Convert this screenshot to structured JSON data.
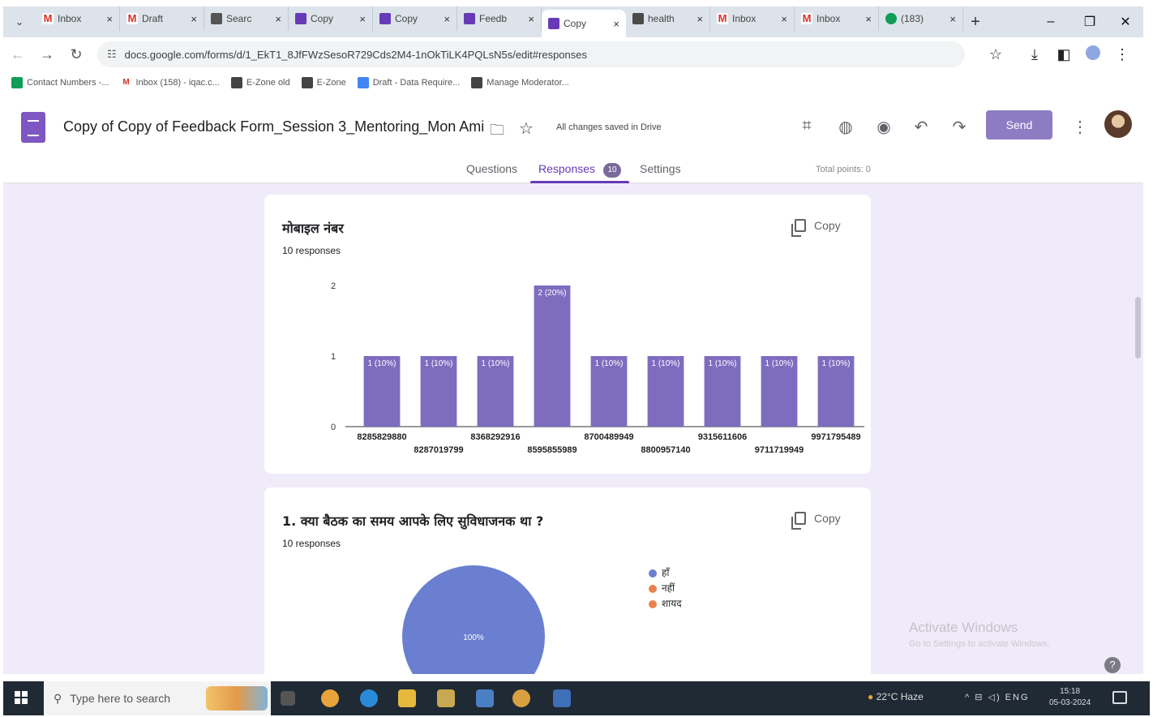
{
  "browser": {
    "tab_search_icon": "chevron-down-icon",
    "tabs": [
      {
        "label": "Inbox",
        "icon": "gmail"
      },
      {
        "label": "Draft",
        "icon": "gmail"
      },
      {
        "label": "Searc",
        "icon": "drive"
      },
      {
        "label": "Copy",
        "icon": "forms"
      },
      {
        "label": "Copy",
        "icon": "forms"
      },
      {
        "label": "Feedb",
        "icon": "forms"
      },
      {
        "label": "Copy",
        "icon": "forms",
        "active": true
      },
      {
        "label": "health",
        "icon": "docs"
      },
      {
        "label": "Inbox",
        "icon": "gmail"
      },
      {
        "label": "Inbox",
        "icon": "gmail"
      },
      {
        "label": "(183)",
        "icon": "web"
      }
    ],
    "tab_close": "×",
    "new_tab": "+",
    "window_controls": {
      "minimize": "–",
      "restore": "❐",
      "close": "✕"
    },
    "url": "docs.google.com/forms/d/1_EkT1_8JfFWzSesoR729Cds2M4-1nOkTiLK4PQLsN5s/edit#responses",
    "bookmarks": [
      {
        "label": "Contact Numbers -...",
        "icon": "sheets",
        "color": "#0f9d58"
      },
      {
        "label": "Inbox (158) - iqac.c...",
        "icon": "gmail",
        "color": "#d93025"
      },
      {
        "label": "E-Zone old",
        "icon": "bookmark",
        "color": "#444"
      },
      {
        "label": "E-Zone",
        "icon": "bookmark",
        "color": "#444"
      },
      {
        "label": "Draft - Data Require...",
        "icon": "docs",
        "color": "#4285f4"
      },
      {
        "label": "Manage Moderator...",
        "icon": "bookmark",
        "color": "#444"
      }
    ]
  },
  "form": {
    "title": "Copy of Copy of Feedback Form_Session 3_Mentoring_Mon Ami",
    "saved_status": "All changes saved in Drive",
    "send_label": "Send",
    "tabs": {
      "questions": "Questions",
      "responses": "Responses",
      "responses_count": "10",
      "settings": "Settings"
    },
    "total_points": "Total points: 0",
    "accent": "#673ab7"
  },
  "cards": {
    "mobile": {
      "title": "मोबाइल नंबर",
      "responses": "10 responses",
      "copy_label": "Copy"
    },
    "q1": {
      "title": "1. क्या  बैठक का समय आपके लिए सुविधाजनक था ?",
      "responses": "10 responses",
      "copy_label": "Copy"
    }
  },
  "chart_data": [
    {
      "type": "bar",
      "categories": [
        "8285829880",
        "8287019799",
        "8368292916",
        "8595855989",
        "8700489949",
        "8800957140",
        "9315611606",
        "9711719949",
        "9971795489"
      ],
      "values": [
        1,
        1,
        1,
        2,
        1,
        1,
        1,
        1,
        1
      ],
      "data_labels": [
        "1 (10%)",
        "1 (10%)",
        "1 (10%)",
        "2 (20%)",
        "1 (10%)",
        "1 (10%)",
        "1 (10%)",
        "1 (10%)",
        "1 (10%)"
      ],
      "yticks": [
        "0",
        "1",
        "2"
      ],
      "ylim": [
        0,
        2
      ],
      "color": "#7e6cbf"
    },
    {
      "type": "pie",
      "slices": [
        {
          "label": "हाँ",
          "value": 100,
          "color": "#6a7fcf"
        },
        {
          "label": "नहीं",
          "value": 0,
          "color": "#e8824d"
        },
        {
          "label": "शायद",
          "value": 0,
          "color": "#e8824d"
        }
      ],
      "slice_label": "100%"
    }
  ],
  "overlay": {
    "watermark_title": "Activate Windows",
    "watermark_sub": "Go to Settings to activate Windows.",
    "help": "?"
  },
  "taskbar": {
    "search_placeholder": "Type here to search",
    "weather": "22°C Haze",
    "tray": "^ ⊟ ◁) ENG",
    "time": "15:18",
    "date": "05-03-2024"
  }
}
